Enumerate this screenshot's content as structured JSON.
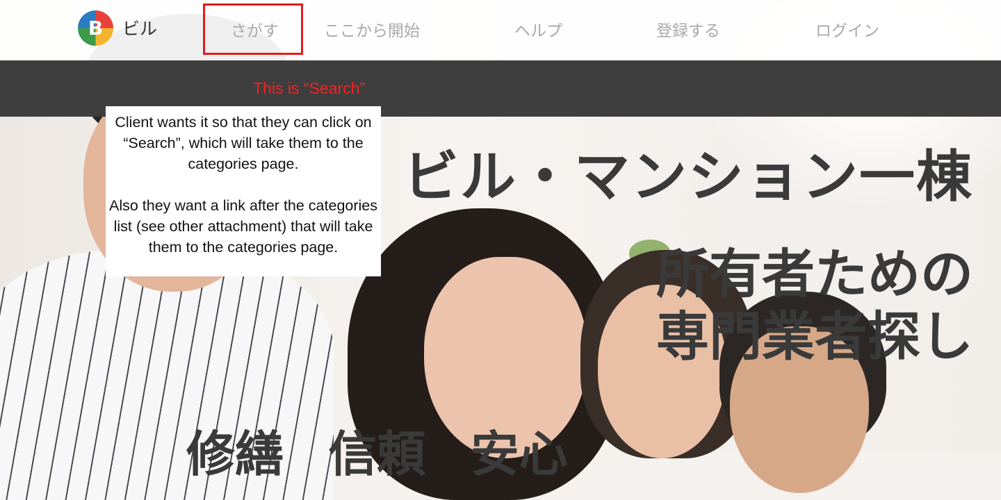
{
  "header": {
    "logo_letter": "B",
    "brand_text": "ビル",
    "nav": {
      "search": "さがす",
      "start": "ここから開始",
      "help": "ヘルプ",
      "signup": "登録する",
      "login": "ログイン"
    }
  },
  "annotation": {
    "search_label": "This is “Search”",
    "comment_paragraph_1": "Client wants it so that they can click on “Search”, which will take them to the categories page.",
    "comment_paragraph_2": "Also they want a link after the categories list (see other attachment) that will take them to the categories page.",
    "highlight_color": "#e41b1b"
  },
  "hero": {
    "title": "ビル・マンション一棟",
    "subtitle_line_1": "所有者ための",
    "subtitle_line_2": "専門業者探し",
    "keywords": "修繕 信頼 安心"
  },
  "colors": {
    "dark_bar": "#3e3e3e",
    "nav_text": "#a9a9a9",
    "heading": "#3a3a3a"
  }
}
